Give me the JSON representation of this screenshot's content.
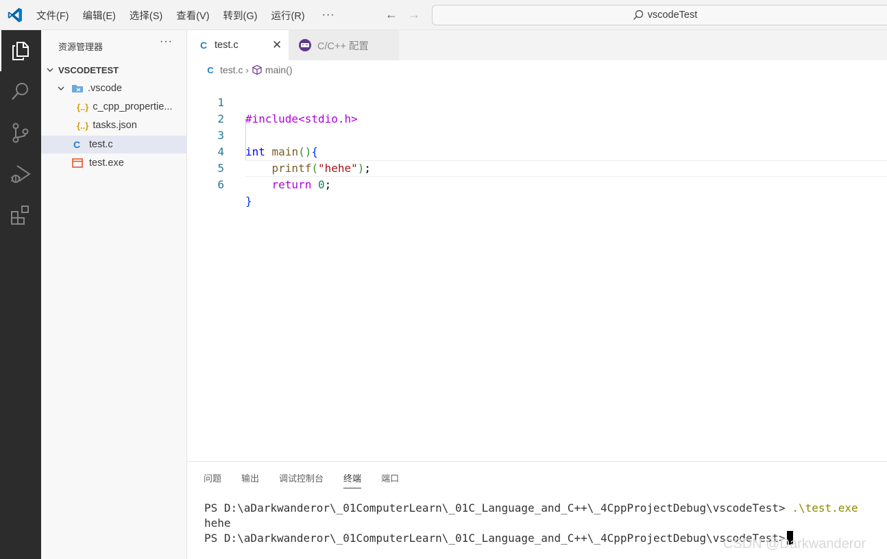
{
  "titlebar": {
    "menu": [
      "文件(F)",
      "编辑(E)",
      "选择(S)",
      "查看(V)",
      "转到(G)",
      "运行(R)"
    ],
    "more": "···",
    "search_text": "vscodeTest"
  },
  "sidebar": {
    "title": "资源管理器",
    "more": "···",
    "root": "VSCODETEST",
    "items": [
      {
        "label": ".vscode",
        "icon": "folder-vscode-icon"
      },
      {
        "label": "c_cpp_propertie...",
        "icon": "json-icon"
      },
      {
        "label": "tasks.json",
        "icon": "json-icon"
      },
      {
        "label": "test.c",
        "icon": "c-file-icon"
      },
      {
        "label": "test.exe",
        "icon": "exe-file-icon"
      }
    ]
  },
  "tabs": [
    {
      "label": "test.c",
      "icon": "C"
    },
    {
      "label": "C/C++ 配置"
    }
  ],
  "breadcrumbs": {
    "file": "test.c",
    "symbol": "main()"
  },
  "code": {
    "line_numbers": [
      "1",
      "2",
      "3",
      "4",
      "5",
      "6"
    ],
    "l1": "#include<stdio.h>",
    "l3_kw": "int",
    "l3_fn": "main",
    "l4_fn": "printf",
    "l4_str": "\"hehe\"",
    "l5_kw": "return",
    "l5_num": "0"
  },
  "panel": {
    "tabs": [
      "问题",
      "输出",
      "调试控制台",
      "终端",
      "端口"
    ],
    "active_tab": "终端",
    "terminal": {
      "prompt1": "PS D:\\aDarkwanderor\\_01ComputerLearn\\_01C_Language_and_C++\\_4CppProjectDebug\\vscodeTest> ",
      "cmd1": ".\\test.exe",
      "output": "hehe",
      "prompt2": "PS D:\\aDarkwanderor\\_01ComputerLearn\\_01C_Language_and_C++\\_4CppProjectDebug\\vscodeTest>"
    }
  },
  "watermark": "CSDN @Darkwanderor",
  "colors": {
    "activity_bar": "#2c2c2c",
    "vscode_blue": "#0065a9",
    "c_icon": "#1f80c8",
    "exe_icon": "#e2562f"
  }
}
